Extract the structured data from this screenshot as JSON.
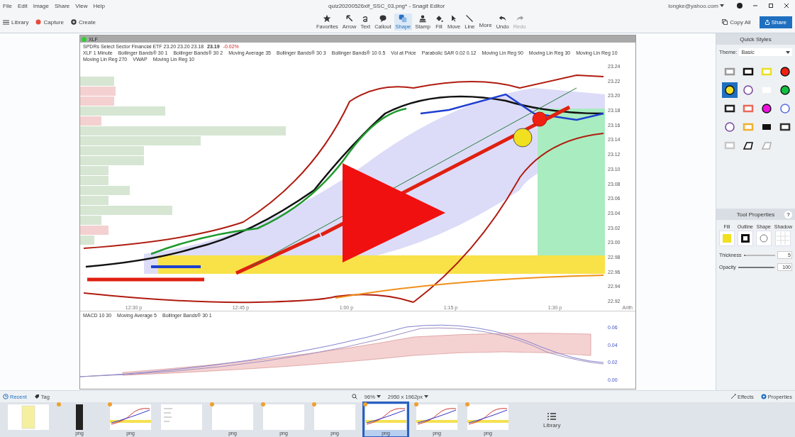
{
  "menu": [
    "File",
    "Edit",
    "Image",
    "Share",
    "View",
    "Help"
  ],
  "window": {
    "title": "quiz20200526xlf_SSC_03.png* - Snagit Editor",
    "account": "longke@yahoo.com"
  },
  "left_actions": [
    {
      "kind": "library",
      "label": "Library"
    },
    {
      "kind": "capture",
      "label": "Capture"
    },
    {
      "kind": "create",
      "label": "Create"
    }
  ],
  "tools": [
    {
      "kind": "star",
      "label": "Favorites",
      "selected": false,
      "disabled": false
    },
    {
      "kind": "arrow",
      "label": "Arrow",
      "selected": false,
      "disabled": false
    },
    {
      "kind": "text",
      "label": "Text",
      "selected": false,
      "disabled": false
    },
    {
      "kind": "callout",
      "label": "Callout",
      "selected": false,
      "disabled": false
    },
    {
      "kind": "shape",
      "label": "Shape",
      "selected": true,
      "disabled": false
    },
    {
      "kind": "stamp",
      "label": "Stamp",
      "selected": false,
      "disabled": false
    },
    {
      "kind": "fill",
      "label": "Fill",
      "selected": false,
      "disabled": false
    },
    {
      "kind": "move",
      "label": "Move",
      "selected": false,
      "disabled": false
    },
    {
      "kind": "line",
      "label": "Line",
      "selected": false,
      "disabled": false
    },
    {
      "kind": "more",
      "label": "More",
      "selected": false,
      "disabled": false
    },
    {
      "kind": "undo",
      "label": "Undo",
      "selected": false,
      "disabled": false
    },
    {
      "kind": "redo",
      "label": "Redo",
      "selected": false,
      "disabled": true
    }
  ],
  "copy_all": "Copy All",
  "share": "Share",
  "chart_image": {
    "symbol": "XLF",
    "name_line": "SPDRs Select Sector Financial ETF  23.20  23.20  23.18",
    "last": "23.19",
    "change": "-0.02%",
    "legend": [
      "XLF 1 Minute",
      "Bollinger Bands® 30 1",
      "Bollinger Bands® 30 2",
      "Moving Average 35",
      "Bollinger Bands® 30 3",
      "Bollinger Bands® 10 0.5",
      "Vol at Price",
      "Parabolic SAR 0.02 0.12",
      "Moving Lin Reg 90",
      "Moving Lin Reg 30",
      "Moving Lin Reg 10",
      "Moving Lin Reg 270",
      "VWAP",
      "Moving Lin Reg 10"
    ],
    "price_ticks": [
      "23.24",
      "23.22",
      "23.20",
      "23.18",
      "23.16",
      "23.14",
      "23.12",
      "23.10",
      "23.08",
      "23.06",
      "23.04",
      "23.02",
      "23.00",
      "22.98",
      "22.96",
      "22.94",
      "22.92"
    ],
    "time_ticks": [
      "12:30 p",
      "12:45 p",
      "1:00 p",
      "1:15 p",
      "1:30 p"
    ],
    "scale_label": "Arith",
    "lower_legend": [
      "MACD 10 30",
      "Moving Average 5",
      "Bollinger Bands® 30 1"
    ],
    "lower_ticks": [
      "0.06",
      "0.04",
      "0.02",
      "0.00"
    ]
  },
  "quick_styles": {
    "title": "Quick Styles",
    "theme_label": "Theme:",
    "theme": "Basic",
    "styles": [
      {
        "kind": "rect",
        "color": "#9a9a9a",
        "selected": false
      },
      {
        "kind": "rect",
        "color": "#111111",
        "selected": false
      },
      {
        "kind": "rect",
        "color": "#e8e020",
        "selected": false
      },
      {
        "kind": "dot",
        "color": "#f02010",
        "selected": false
      },
      {
        "kind": "dot",
        "color": "#f0e020",
        "selected": true
      },
      {
        "kind": "circle",
        "color": "#7a4aa0",
        "selected": false
      },
      {
        "kind": "plain",
        "color": "#ffffff",
        "selected": false
      },
      {
        "kind": "dot",
        "color": "#10c040",
        "selected": false
      },
      {
        "kind": "rect",
        "color": "#222222",
        "selected": false
      },
      {
        "kind": "rect",
        "color": "#e86a5a",
        "selected": false
      },
      {
        "kind": "dot",
        "color": "#f010e0",
        "selected": false
      },
      {
        "kind": "circle",
        "color": "#5a70e0",
        "selected": false
      },
      {
        "kind": "circle",
        "color": "#7a4aa0",
        "selected": false
      },
      {
        "kind": "rect",
        "color": "#f0b030",
        "selected": false
      },
      {
        "kind": "block",
        "color": "#111111",
        "selected": false
      },
      {
        "kind": "rect",
        "color": "#333333",
        "selected": false
      },
      {
        "kind": "rect",
        "color": "#c8c8c8",
        "selected": false
      },
      {
        "kind": "slant",
        "color": "#111111",
        "selected": false
      },
      {
        "kind": "slant",
        "color": "#b0b0b0",
        "selected": false
      }
    ]
  },
  "tool_properties": {
    "title": "Tool Properties",
    "help": "?",
    "fill": {
      "label": "Fill",
      "color": "#f0e020"
    },
    "outline_label": "Outline",
    "shape_label": "Shape",
    "shadow_label": "Shadow",
    "thickness": {
      "label": "Thickness",
      "level": 0.05,
      "value": "5"
    },
    "opacity": {
      "label": "Opacity",
      "level": 0.96,
      "value": "100"
    }
  },
  "tray": {
    "recent": "Recent",
    "tag": "Tag",
    "zoom": "96%",
    "size": "2950 x 1962px",
    "effects": "Effects",
    "properties": "Properties",
    "library": "Library",
    "items": [
      {
        "kind": "document",
        "badge": false,
        "selected": false
      },
      {
        "kind": "dark",
        "label": "png",
        "badge": true,
        "selected": false
      },
      {
        "kind": "chart",
        "label": "png",
        "badge": true,
        "selected": false
      },
      {
        "kind": "list",
        "badge": false,
        "selected": false
      },
      {
        "kind": "blank",
        "label": "png",
        "badge": true,
        "selected": false
      },
      {
        "kind": "blank",
        "label": "png",
        "badge": true,
        "selected": false
      },
      {
        "kind": "blank",
        "label": "png",
        "badge": true,
        "selected": false
      },
      {
        "kind": "chart",
        "label": "png",
        "badge": true,
        "selected": true
      },
      {
        "kind": "chart",
        "label": "png",
        "badge": true,
        "selected": false
      },
      {
        "kind": "chart",
        "label": "png",
        "badge": true,
        "selected": false
      }
    ]
  }
}
